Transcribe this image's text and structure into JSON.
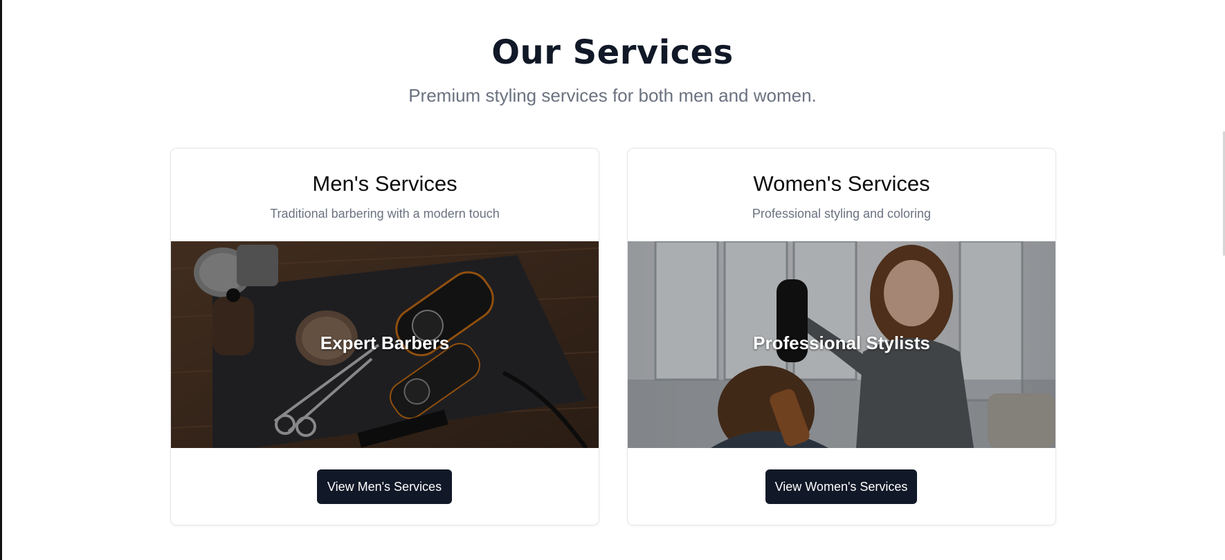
{
  "section": {
    "title": "Our Services",
    "subtitle": "Premium styling services for both men and women."
  },
  "cards": [
    {
      "title": "Men's Services",
      "description": "Traditional barbering with a modern touch",
      "image_label": "Expert Barbers",
      "button_label": "View Men's Services"
    },
    {
      "title": "Women's Services",
      "description": "Professional styling and coloring",
      "image_label": "Professional Stylists",
      "button_label": "View Women's Services"
    }
  ],
  "colors": {
    "primary_dark": "#111827",
    "muted_text": "#6b7280",
    "card_border": "#e5e7eb"
  }
}
